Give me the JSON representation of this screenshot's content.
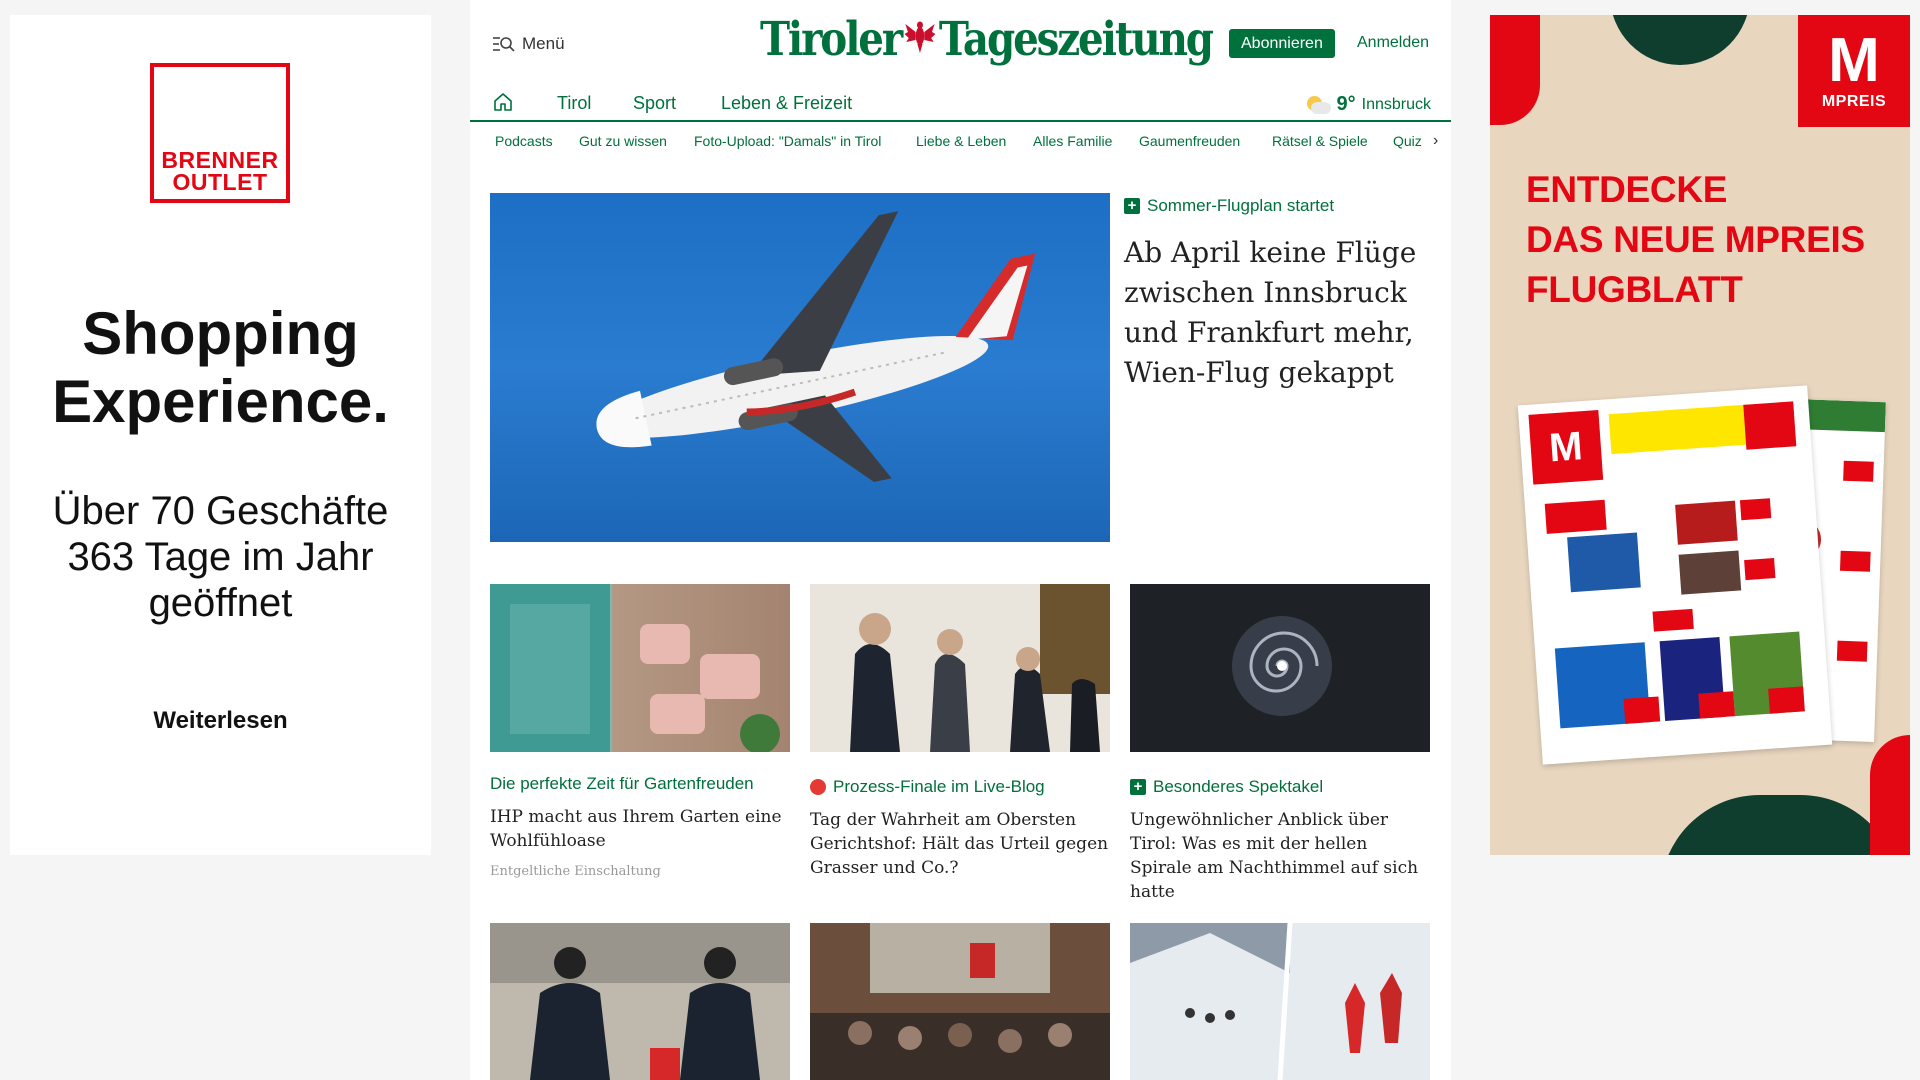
{
  "ad_left": {
    "brand_line1": "BRENNER",
    "brand_line2": "OUTLET",
    "headline1": "Shopping",
    "headline2": "Experience.",
    "sub1": "Über 70 Geschäfte",
    "sub2": "363 Tage im Jahr",
    "sub3": "geöffnet",
    "more": "Weiterlesen"
  },
  "header": {
    "menu_label": "Menü",
    "logo_part1": "Tiroler",
    "logo_part2": "Tageszeitung",
    "subscribe_label": "Abonnieren",
    "login_label": "Anmelden"
  },
  "nav": {
    "items": [
      "Tirol",
      "Sport",
      "Leben & Freizeit"
    ],
    "weather_temp": "9°",
    "weather_city": "Innsbruck"
  },
  "subnav": {
    "items": [
      "Podcasts",
      "Gut zu wissen",
      "Foto-Upload: \"Damals\" in Tirol",
      "Liebe & Leben",
      "Alles Familie",
      "Gaumenfreuden",
      "Rätsel & Spiele",
      "Quiz"
    ]
  },
  "hero": {
    "kicker": "Sommer-Flugplan startet",
    "title": "Ab April keine Flüge zwischen Innsbruck und Frankfurt mehr, Wien-Flug gekappt"
  },
  "cards": [
    {
      "kicker": "Die perfekte Zeit für Gartenfreuden",
      "title": "IHP macht aus Ihrem Garten eine Wohlfühloase",
      "note": "Entgeltliche Einschaltung"
    },
    {
      "kicker": "Prozess-Finale im Live-Blog",
      "title": "Tag der Wahrheit am Obersten Gerichtshof: Hält das Urteil gegen Grasser und Co.?"
    },
    {
      "kicker": "Besonderes Spektakel",
      "title": "Ungewöhnlicher Anblick über Tirol: Was es mit der hellen Spirale am Nachthimmel auf sich hatte"
    }
  ],
  "ad_right": {
    "logo_letter": "M",
    "logo_text": "MPREIS",
    "line1": "ENTDECKE",
    "line2": "DAS NEUE MPREIS",
    "line3": "FLUGBLATT"
  },
  "colors": {
    "brand_green": "#00703c",
    "mpreis_red": "#e30613",
    "live_red": "#e53935"
  }
}
